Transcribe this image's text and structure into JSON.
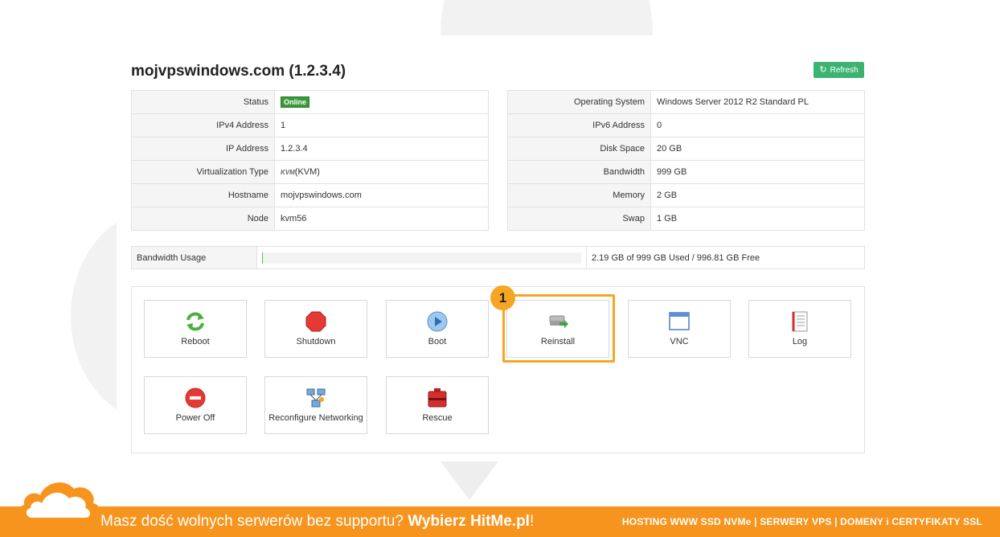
{
  "page": {
    "title": "mojvpswindows.com (1.2.3.4)",
    "refresh_label": "Refresh"
  },
  "info_left": [
    {
      "key": "Status",
      "value": "Online",
      "badge": true
    },
    {
      "key": "IPv4 Address",
      "value": "1"
    },
    {
      "key": "IP Address",
      "value": "1.2.3.4"
    },
    {
      "key": "Virtualization Type",
      "value": "(KVM)",
      "logo": "KVM"
    },
    {
      "key": "Hostname",
      "value": "mojvpswindows.com"
    },
    {
      "key": "Node",
      "value": "kvm56"
    }
  ],
  "info_right": [
    {
      "key": "Operating System",
      "value": "Windows Server 2012 R2 Standard PL"
    },
    {
      "key": "IPv6 Address",
      "value": "0"
    },
    {
      "key": "Disk Space",
      "value": "20 GB"
    },
    {
      "key": "Bandwidth",
      "value": "999 GB"
    },
    {
      "key": "Memory",
      "value": "2 GB"
    },
    {
      "key": "Swap",
      "value": "1 GB"
    }
  ],
  "bandwidth": {
    "label": "Bandwidth Usage",
    "used_fraction": 0.002,
    "summary": "2.19 GB of 999 GB Used / 996.81 GB Free"
  },
  "actions": [
    {
      "id": "reboot",
      "label": "Reboot",
      "icon": "reboot-icon"
    },
    {
      "id": "shutdown",
      "label": "Shutdown",
      "icon": "shutdown-icon"
    },
    {
      "id": "boot",
      "label": "Boot",
      "icon": "boot-icon"
    },
    {
      "id": "reinstall",
      "label": "Reinstall",
      "icon": "reinstall-icon"
    },
    {
      "id": "vnc",
      "label": "VNC",
      "icon": "vnc-window-icon"
    },
    {
      "id": "log",
      "label": "Log",
      "icon": "log-document-icon"
    },
    {
      "id": "power-off",
      "label": "Power Off",
      "icon": "power-off-icon"
    },
    {
      "id": "reconfigure-networking",
      "label": "Reconfigure Networking",
      "icon": "network-icon"
    },
    {
      "id": "rescue",
      "label": "Rescue",
      "icon": "rescue-icon"
    }
  ],
  "annotation": {
    "step_number": "1",
    "highlight_color": "#f5a623"
  },
  "colors": {
    "accent_green": "#3cb371",
    "badge_green": "#3a9a3a",
    "footer_orange": "#f7941d"
  },
  "footer": {
    "text": "Masz dość wolnych serwerów bez supportu? ",
    "brand": "Wybierz HitMe.pl",
    "suffix": "!",
    "right": "HOSTING WWW SSD NVMe | SERWERY VPS | DOMENY i CERTYFIKATY SSL"
  }
}
